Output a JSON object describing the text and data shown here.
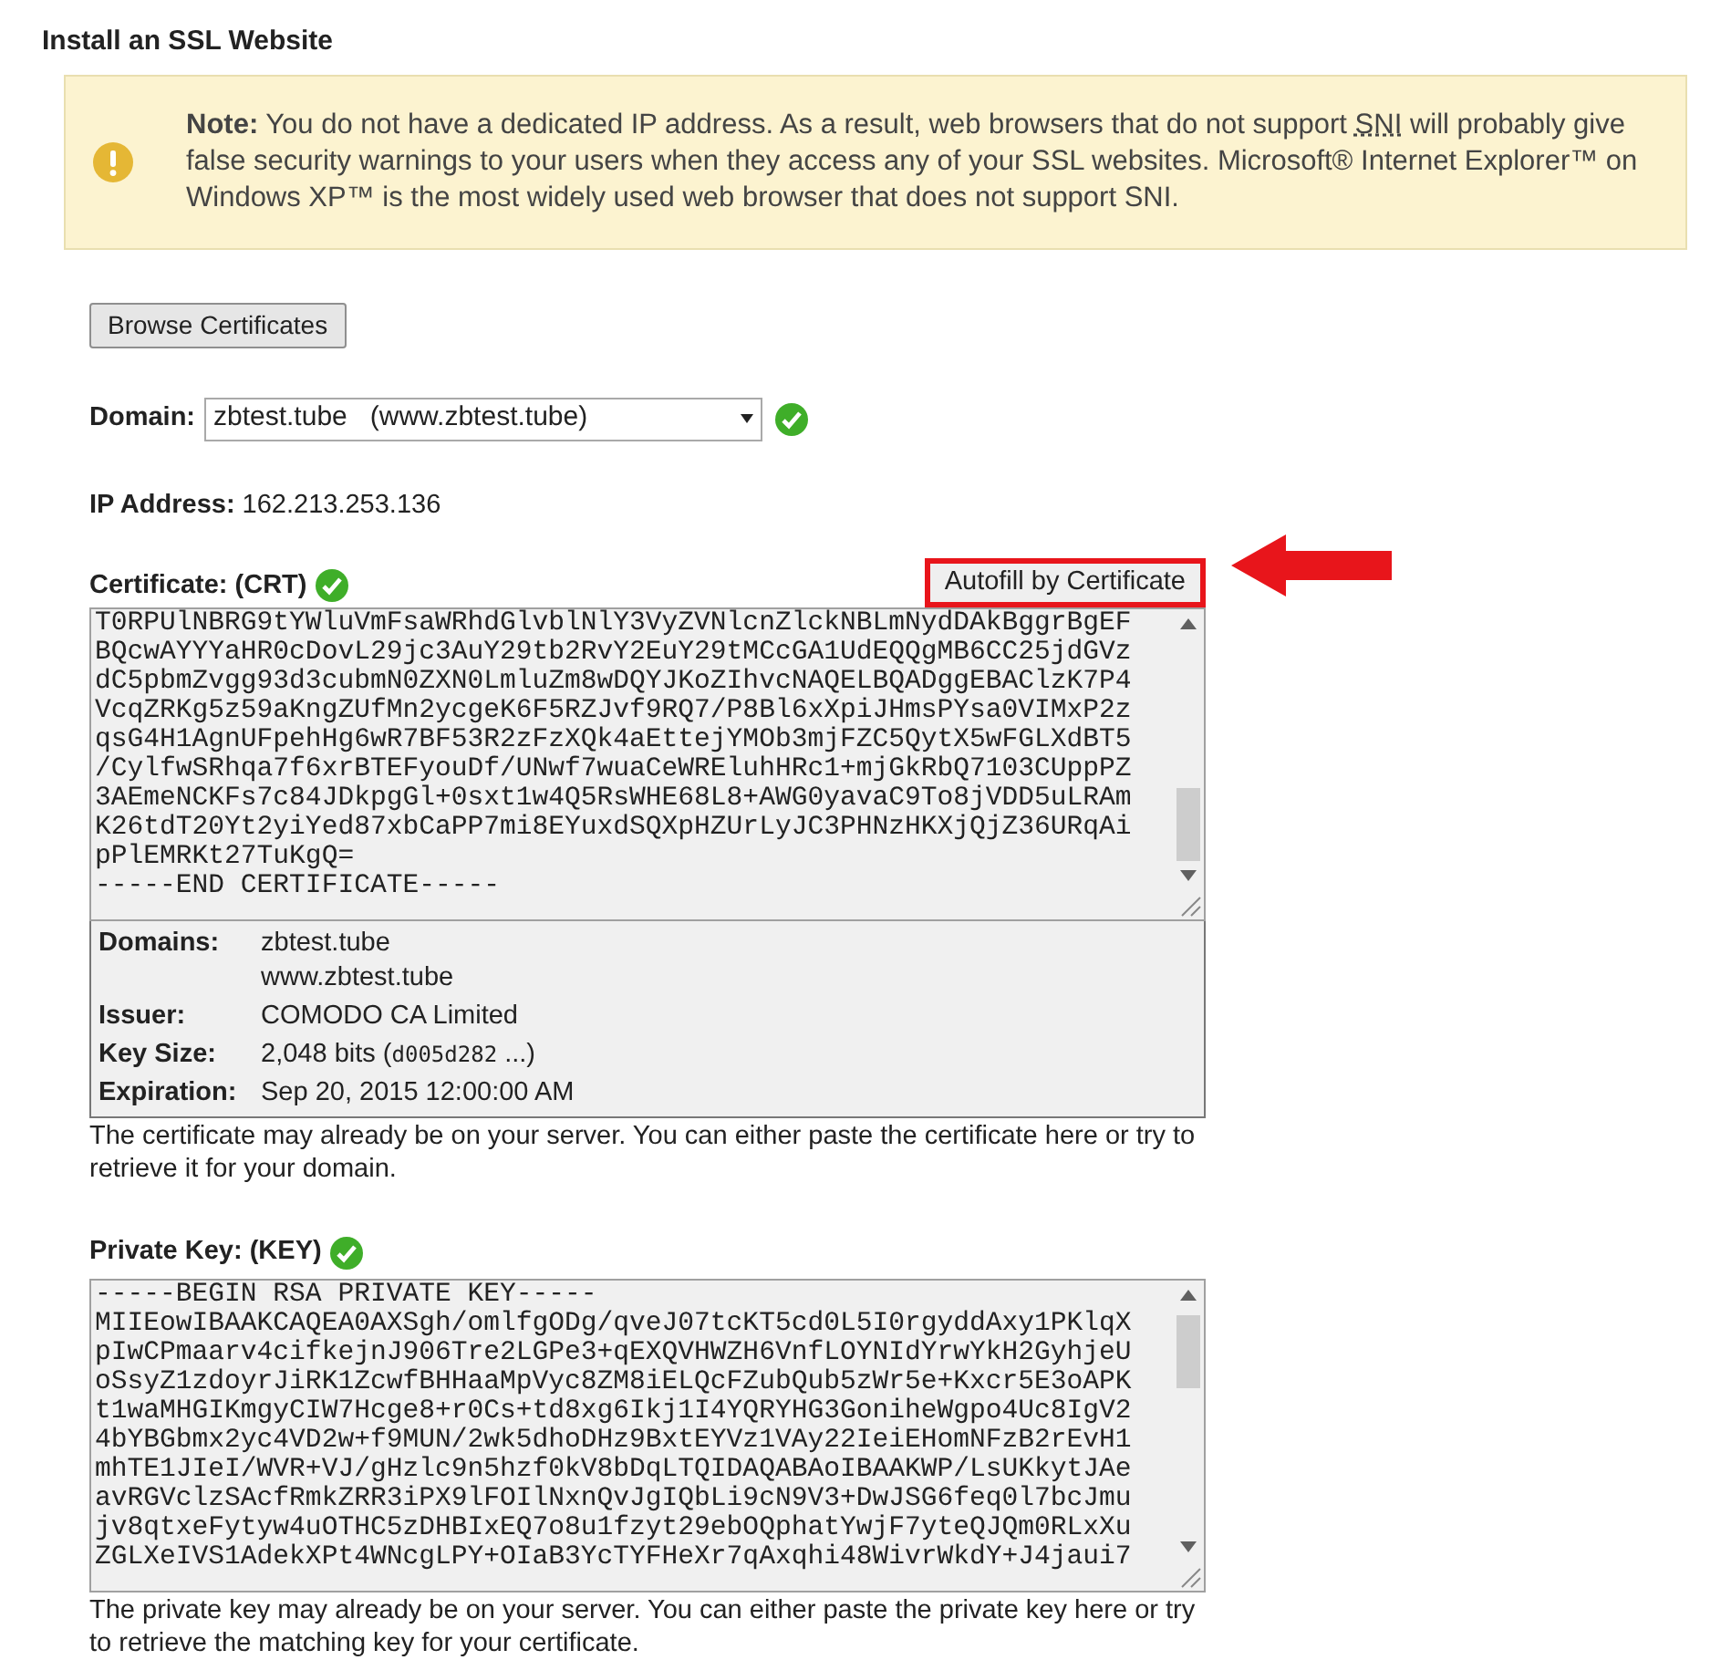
{
  "title": "Install an SSL Website",
  "note": {
    "label": "Note:",
    "text_before": "You do not have a dedicated IP address. As a result, web browsers that do not support",
    "abbr": "SNI",
    "text_after": "will probably give false security warnings to your users when they access any of your SSL websites. Microsoft® Internet Explorer™ on Windows XP™ is the most widely used web browser that does not support SNI."
  },
  "browse_button": "Browse Certificates",
  "domain": {
    "label": "Domain:",
    "value": "zbtest.tube   (www.zbtest.tube)",
    "valid": true
  },
  "ip": {
    "label": "IP Address:",
    "value": "162.213.253.136"
  },
  "certificate": {
    "label": "Certificate: (CRT)",
    "valid": true,
    "autofill_button": "Autofill by Certificate",
    "highlighted": true,
    "lines": [
      "T0RPUlNBRG9tYWluVmFsaWRhdGlvblNlY3VyZVNlcnZlckNBLmNydDAkBggrBgEF",
      "BQcwAYYYaHR0cDovL29jc3AuY29tb2RvY2EuY29tMCcGA1UdEQQgMB6CC25jdGVz",
      "dC5pbmZvgg93d3cubmN0ZXN0LmluZm8wDQYJKoZIhvcNAQELBQADggEBAClzK7P4",
      "VcqZRKg5z59aKngZUfMn2ycgeK6F5RZJvf9RQ7/P8Bl6xXpiJHmsPYsa0VIMxP2z",
      "qsG4H1AgnUFpehHg6wR7BF53R2zFzXQk4aEttejYMOb3mjFZC5QytX5wFGLXdBT5",
      "/CylfwSRhqa7f6xrBTEFyouDf/UNwf7wuaCeWREluhHRc1+mjGkRbQ7103CUppPZ",
      "3AEmeNCKFs7c84JDkpgGl+0sxt1w4Q5RsWHE68L8+AWG0yavaC9To8jVDD5uLRAm",
      "K26tdT20Yt2yiYed87xbCaPP7mi8EYuxdSQXpHZUrLyJC3PHNzHKXjQjZ36URqAi",
      "pPlEMRKt27TuKgQ=",
      "-----END CERTIFICATE-----"
    ],
    "details": [
      {
        "label": "Domains:",
        "values": [
          "zbtest.tube",
          "www.zbtest.tube"
        ]
      },
      {
        "label": "Issuer:",
        "values": [
          "COMODO CA Limited"
        ]
      },
      {
        "label": "Key Size:",
        "values": [
          "2,048 bits ("
        ],
        "code": "d005d282",
        "suffix": " ...)"
      },
      {
        "label": "Expiration:",
        "values": [
          "Sep 20, 2015 12:00:00 AM"
        ]
      }
    ],
    "help": "The certificate may already be on your server. You can either paste the certificate here or try to retrieve it for your domain."
  },
  "private_key": {
    "label": "Private Key: (KEY)",
    "valid": true,
    "lines": [
      "-----BEGIN RSA PRIVATE KEY-----",
      "MIIEowIBAAKCAQEA0AXSgh/omlfgODg/qveJ07tcKT5cd0L5I0rgyddAxy1PKlqX",
      "pIwCPmaarv4cifkejnJ906Tre2LGPe3+qEXQVHWZH6VnfLOYNIdYrwYkH2GyhjeU",
      "oSsyZ1zdoyrJiRK1ZcwfBHHaaMpVyc8ZM8iELQcFZubQub5zWr5e+Kxcr5E3oAPK",
      "t1waMHGIKmgyCIW7Hcge8+r0Cs+td8xg6Ikj1I4YQRYHG3GoniheWgpo4Uc8IgV2",
      "4bYBGbmx2yc4VD2w+f9MUN/2wk5dhoDHz9BxtEYVz1VAy22IeiEHomNFzB2rEvH1",
      "mhTE1JIeI/WVR+VJ/gHzlc9n5hzf0kV8bDqLTQIDAQABAoIBAAKWP/LsUKkytJAe",
      "avRGVclzSAcfRmkZRR3iPX9lFOIlNxnQvJgIQbLi9cN9V3+DwJSG6feq0l7bcJmu",
      "jv8qtxeFytyw4uOTHC5zDHBIxEQ7o8u1fzyt29ebOQphatYwjF7yteQJQm0RLxXu",
      "ZGLXeIVS1AdekXPt4WNcgLPY+OIaB3YcTYFHeXr7qAxqhi48WivrWkdY+J4jaui7"
    ],
    "help": "The private key may already be on your server. You can either paste the private key here or try to retrieve the matching key for your certificate."
  }
}
